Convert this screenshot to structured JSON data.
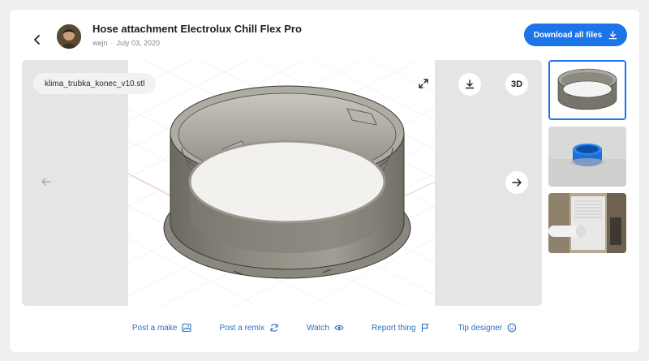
{
  "header": {
    "title": "Hose attachment Electrolux Chill Flex Pro",
    "author": "wejn",
    "date": "July 03, 2020",
    "download_label": "Download all files"
  },
  "viewer": {
    "filename": "klima_trubka_konec_v10.stl",
    "mode_label": "3D"
  },
  "thumbnails": [
    {
      "name": "thumb-render-grey"
    },
    {
      "name": "thumb-render-blue"
    },
    {
      "name": "thumb-photo-unit"
    }
  ],
  "actions": [
    {
      "label": "Post a make",
      "icon": "image-icon"
    },
    {
      "label": "Post a remix",
      "icon": "refresh-icon"
    },
    {
      "label": "Watch",
      "icon": "eye-icon"
    },
    {
      "label": "Report thing",
      "icon": "flag-icon"
    },
    {
      "label": "Tip designer",
      "icon": "smile-icon"
    }
  ],
  "colors": {
    "accent": "#1b74e8",
    "link": "#2b6fbf",
    "viewer_bg": "#e5e5e5"
  }
}
